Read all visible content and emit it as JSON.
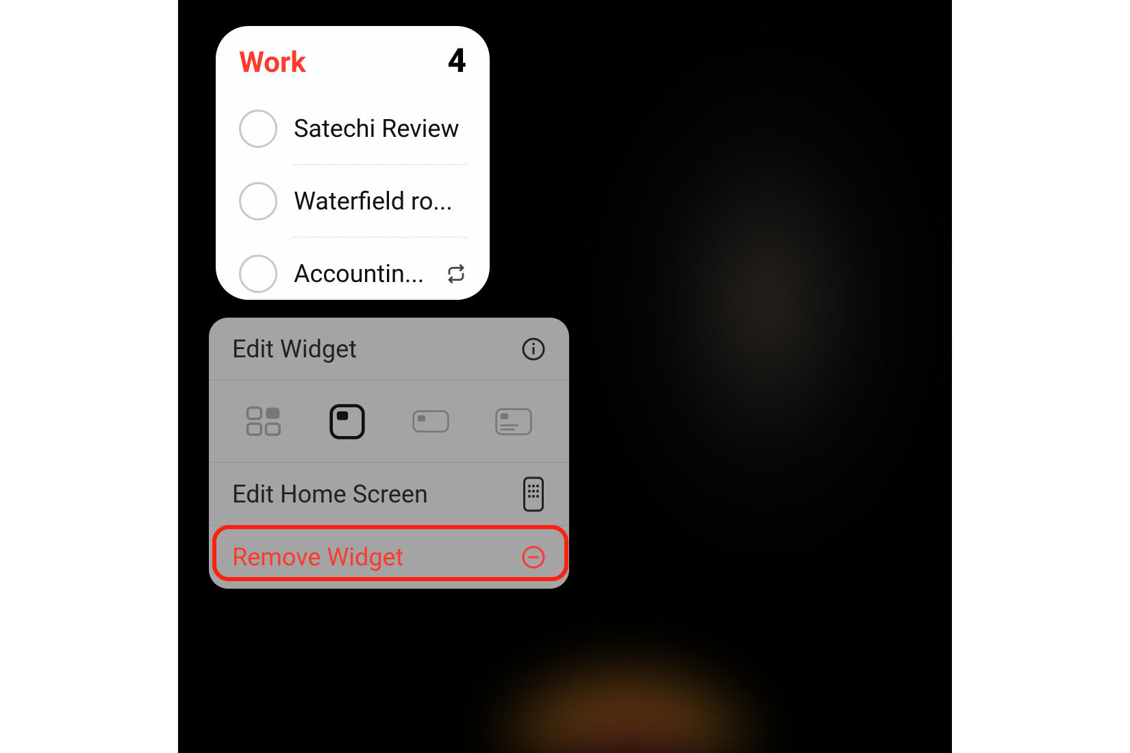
{
  "colors": {
    "accent": "#ff3b30",
    "destructive": "#ff3b30"
  },
  "widget": {
    "title": "Work",
    "count": "4",
    "items": [
      {
        "label": "Satechi Review",
        "recurring": false
      },
      {
        "label": "Waterfield ro...",
        "recurring": false
      },
      {
        "label": "Accountin...",
        "recurring": true
      }
    ]
  },
  "menu": {
    "edit_widget_label": "Edit Widget",
    "edit_home_screen_label": "Edit Home Screen",
    "remove_widget_label": "Remove Widget",
    "size_options": [
      {
        "name": "small-grid",
        "selected": false
      },
      {
        "name": "small-square",
        "selected": true
      },
      {
        "name": "medium-rect",
        "selected": false
      },
      {
        "name": "large-rect",
        "selected": false
      }
    ]
  }
}
